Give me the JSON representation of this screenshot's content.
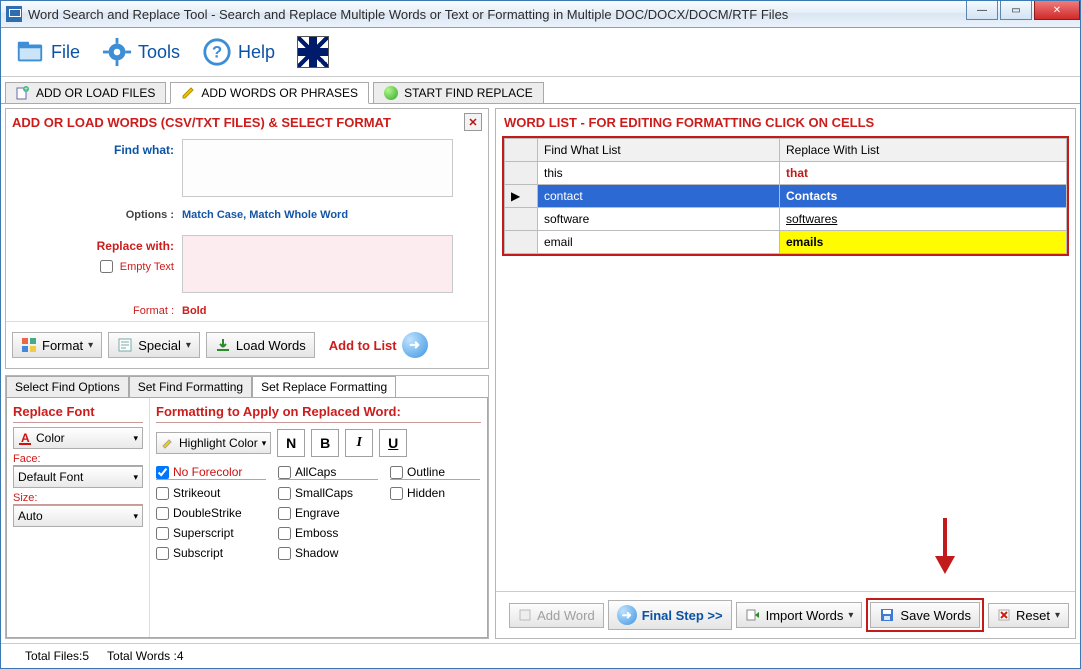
{
  "window": {
    "title": "Word Search and Replace Tool - Search and Replace Multiple Words or Text  or Formatting in Multiple DOC/DOCX/DOCM/RTF Files"
  },
  "menu": {
    "file": "File",
    "tools": "Tools",
    "help": "Help"
  },
  "main_tabs": {
    "add_files": "ADD OR LOAD FILES",
    "add_words": "ADD WORDS OR PHRASES",
    "start": "START FIND REPLACE"
  },
  "left_panel": {
    "title": "ADD OR LOAD WORDS (CSV/TXT FILES) & SELECT FORMAT",
    "find_label": "Find what:",
    "options_label": "Options :",
    "options_value": "Match Case, Match Whole Word",
    "replace_label": "Replace with:",
    "empty_text": "Empty Text",
    "format_label": "Format :",
    "format_value": "Bold",
    "btn_format": "Format",
    "btn_special": "Special",
    "btn_load": "Load Words",
    "btn_add": "Add to List"
  },
  "inner_tabs": {
    "t1": "Select Find Options",
    "t2": "Set Find Formatting",
    "t3": "Set Replace Formatting"
  },
  "fmt": {
    "replace_font": "Replace Font",
    "apply_head": "Formatting to Apply on Replaced Word:",
    "color": "Color",
    "face": "Face:",
    "default_font": "Default Font",
    "size": "Size:",
    "auto": "Auto",
    "highlight": "Highlight Color",
    "N": "N",
    "B": "B",
    "I": "I",
    "U": "U",
    "no_fore": "No Forecolor",
    "allcaps": "AllCaps",
    "outline": "Outline",
    "strike": "Strikeout",
    "smallcaps": "SmallCaps",
    "hidden": "Hidden",
    "dbl": "DoubleStrike",
    "engrave": "Engrave",
    "super": "Superscript",
    "emboss": "Emboss",
    "sub": "Subscript",
    "shadow": "Shadow"
  },
  "wordlist": {
    "title": "WORD LIST - FOR EDITING FORMATTING CLICK ON CELLS",
    "col_find": "Find What List",
    "col_replace": "Replace With List",
    "rows": [
      {
        "find": "this",
        "replace": "that",
        "find_style": "plain",
        "replace_style": "red"
      },
      {
        "find": "contact",
        "replace": "Contacts",
        "find_style": "sel",
        "replace_style": "red"
      },
      {
        "find": "software",
        "replace": "softwares",
        "find_style": "plain",
        "replace_style": "ul"
      },
      {
        "find": "email",
        "replace": "emails",
        "find_style": "plain",
        "replace_style": "yellow"
      }
    ]
  },
  "right_buttons": {
    "add_word": "Add Word",
    "final_step": "Final Step >>",
    "import": "Import Words",
    "save": "Save Words",
    "reset": "Reset"
  },
  "status": {
    "total_files": "Total Files:5",
    "total_words": "Total Words :4"
  }
}
